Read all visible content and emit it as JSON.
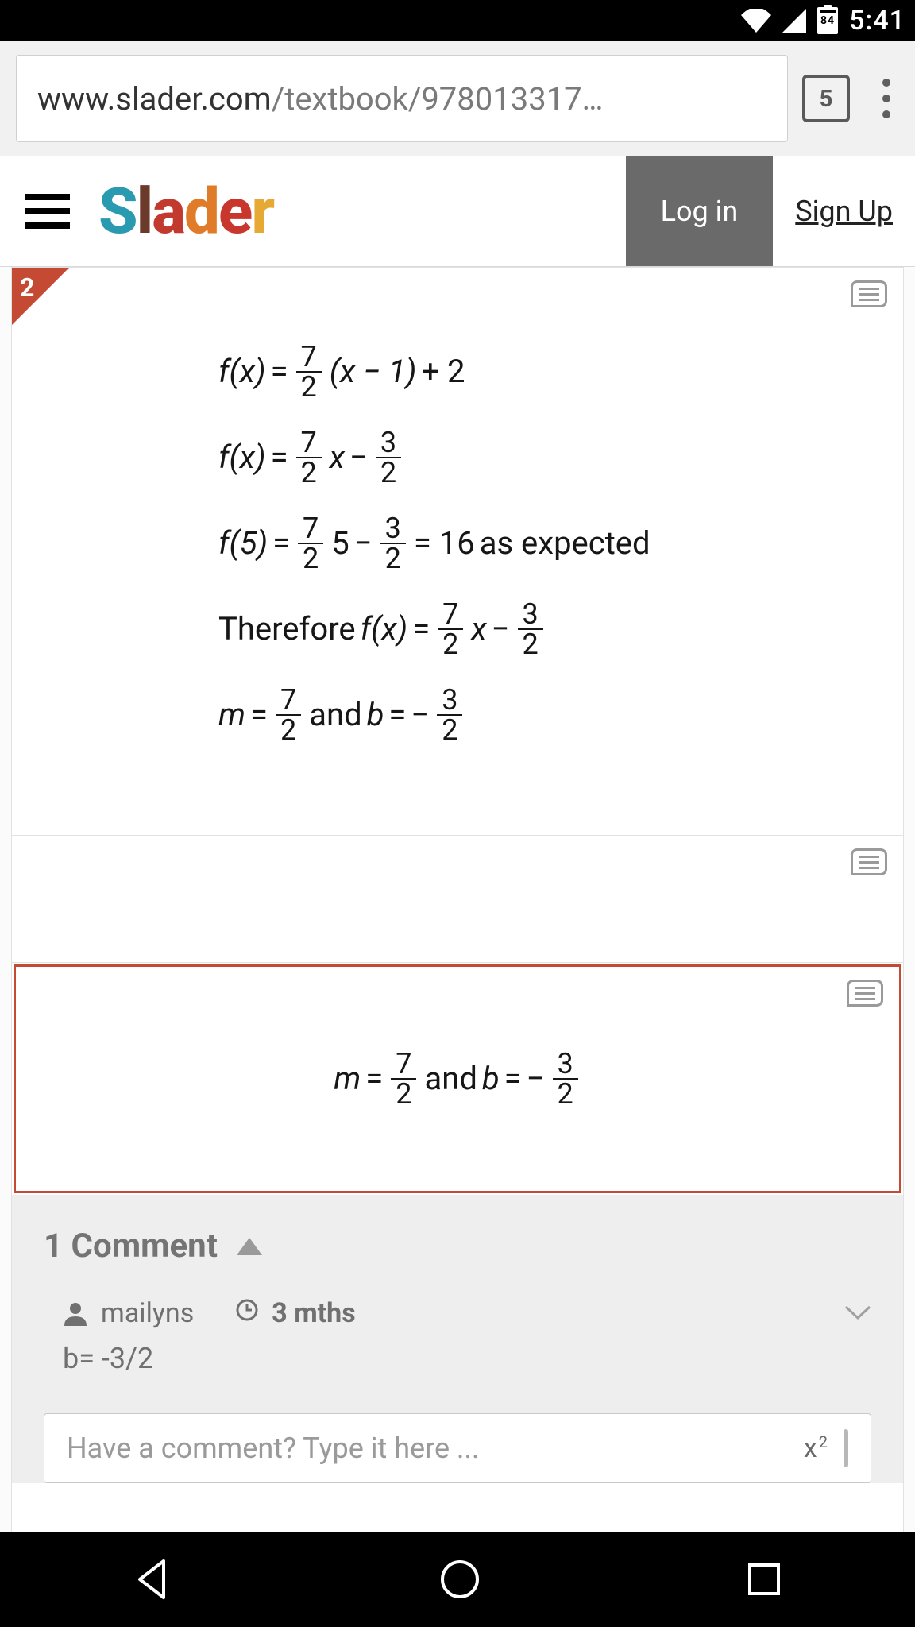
{
  "status": {
    "battery_pct": "84",
    "time": "5:41"
  },
  "browser": {
    "url_host": "www.slader.com",
    "url_tail": "/textbook/978013317…",
    "tab_count": "5"
  },
  "header": {
    "logo_letters": [
      "S",
      "l",
      "a",
      "d",
      "e",
      "r"
    ],
    "login": "Log in",
    "signup": "Sign Up"
  },
  "solution": {
    "step_number": "2",
    "line1": {
      "lhs": "f(x)",
      "frac1_num": "7",
      "frac1_den": "2",
      "mult": "(x − 1)",
      "plus": "+ 2"
    },
    "line2": {
      "lhs": "f(x)",
      "frac1_num": "7",
      "frac1_den": "2",
      "var": "x",
      "minus": " − ",
      "frac2_num": "3",
      "frac2_den": "2"
    },
    "line3": {
      "lhs": "f(5)",
      "frac1_num": "7",
      "frac1_den": "2",
      "val5": "5",
      "minus": " − ",
      "frac2_num": "3",
      "frac2_den": "2",
      "eq": " = 16",
      "tail": " as expected"
    },
    "line4": {
      "pre": "Therefore ",
      "lhs": "f(x)",
      "frac1_num": "7",
      "frac1_den": "2",
      "var": "x",
      "minus": " − ",
      "frac2_num": "3",
      "frac2_den": "2"
    },
    "line5": {
      "m": "m",
      "frac1_num": "7",
      "frac1_den": "2",
      "mid": " and ",
      "b": "b",
      "neg": " − ",
      "frac2_num": "3",
      "frac2_den": "2"
    }
  },
  "answer": {
    "m": "m",
    "frac1_num": "7",
    "frac1_den": "2",
    "mid": " and ",
    "b": "b",
    "neg": " − ",
    "frac2_num": "3",
    "frac2_den": "2"
  },
  "comments": {
    "heading": "1 Comment",
    "items": [
      {
        "user": "mailyns",
        "age": "3 mths",
        "body": "b= -3/2"
      }
    ],
    "input_placeholder": "Have a comment? Type it here ...",
    "sup_btn": "x²"
  }
}
